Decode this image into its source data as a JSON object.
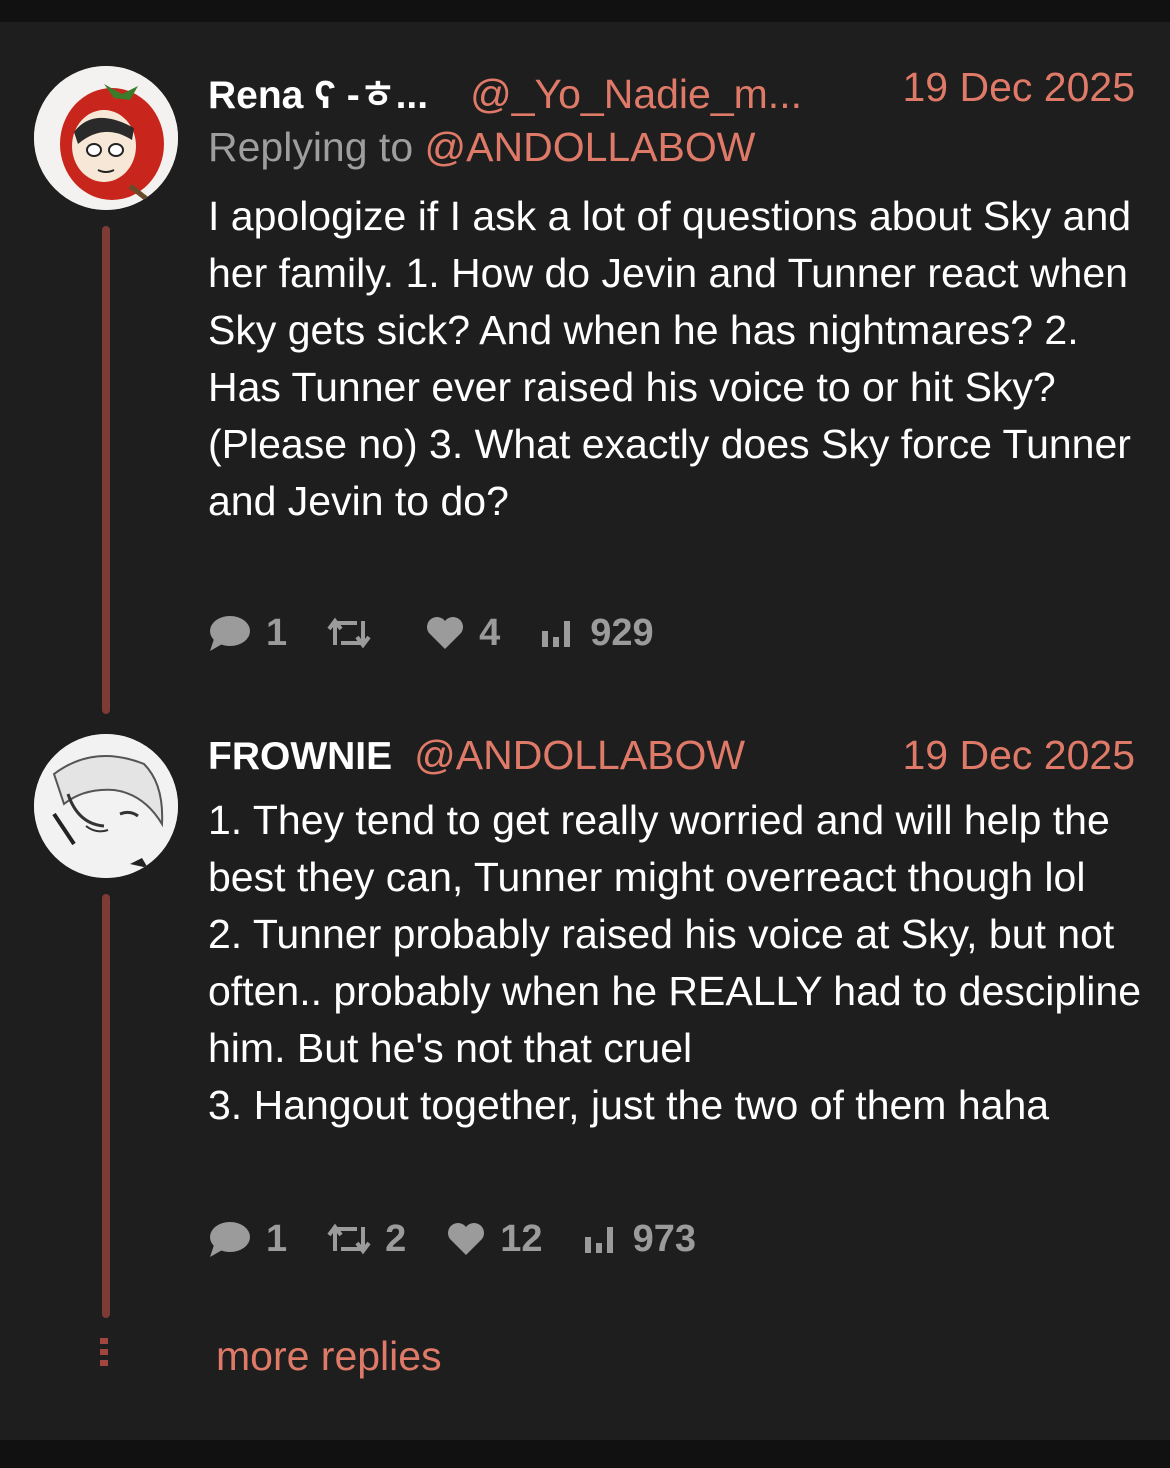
{
  "thread": {
    "more_replies_label": "more replies",
    "posts": [
      {
        "author_name": "Rena ʕ -ㅎ...",
        "author_handle": "@_Yo_Nadie_m...",
        "date": "19 Dec 2025",
        "replying_prefix": "Replying to",
        "replying_to": "@ANDOLLABOW",
        "text": "I apologize if I ask a lot of questions about Sky and her family. 1. How do Jevin and Tunner react when Sky gets sick? And when he has nightmares? 2. Has Tunner ever raised his voice to or hit Sky? (Please no) 3. What exactly does Sky force Tunner and Jevin to do?",
        "stats": {
          "replies": "1",
          "reposts": "",
          "likes": "4",
          "views": "929"
        }
      },
      {
        "author_name": "FROWNIE",
        "author_handle": "@ANDOLLABOW",
        "date": "19 Dec 2025",
        "lines": [
          "1. They tend to get really worried and will help the best they can, Tunner might overreact though lol",
          "2. Tunner probably raised his voice at Sky, but not often.. probably when he REALLY had to descipline him. But he's not that cruel",
          "3. Hangout together, just the two of them haha"
        ],
        "stats": {
          "replies": "1",
          "reposts": "2",
          "likes": "12",
          "views": "973"
        }
      }
    ]
  },
  "icons": [
    "reply-icon",
    "repost-icon",
    "like-icon",
    "views-icon",
    "more-dots-icon"
  ],
  "colors": {
    "background": "#1e1e1e",
    "accent": "#e07a68",
    "thread_line": "#7e3b35",
    "muted": "#9b9b9b"
  }
}
